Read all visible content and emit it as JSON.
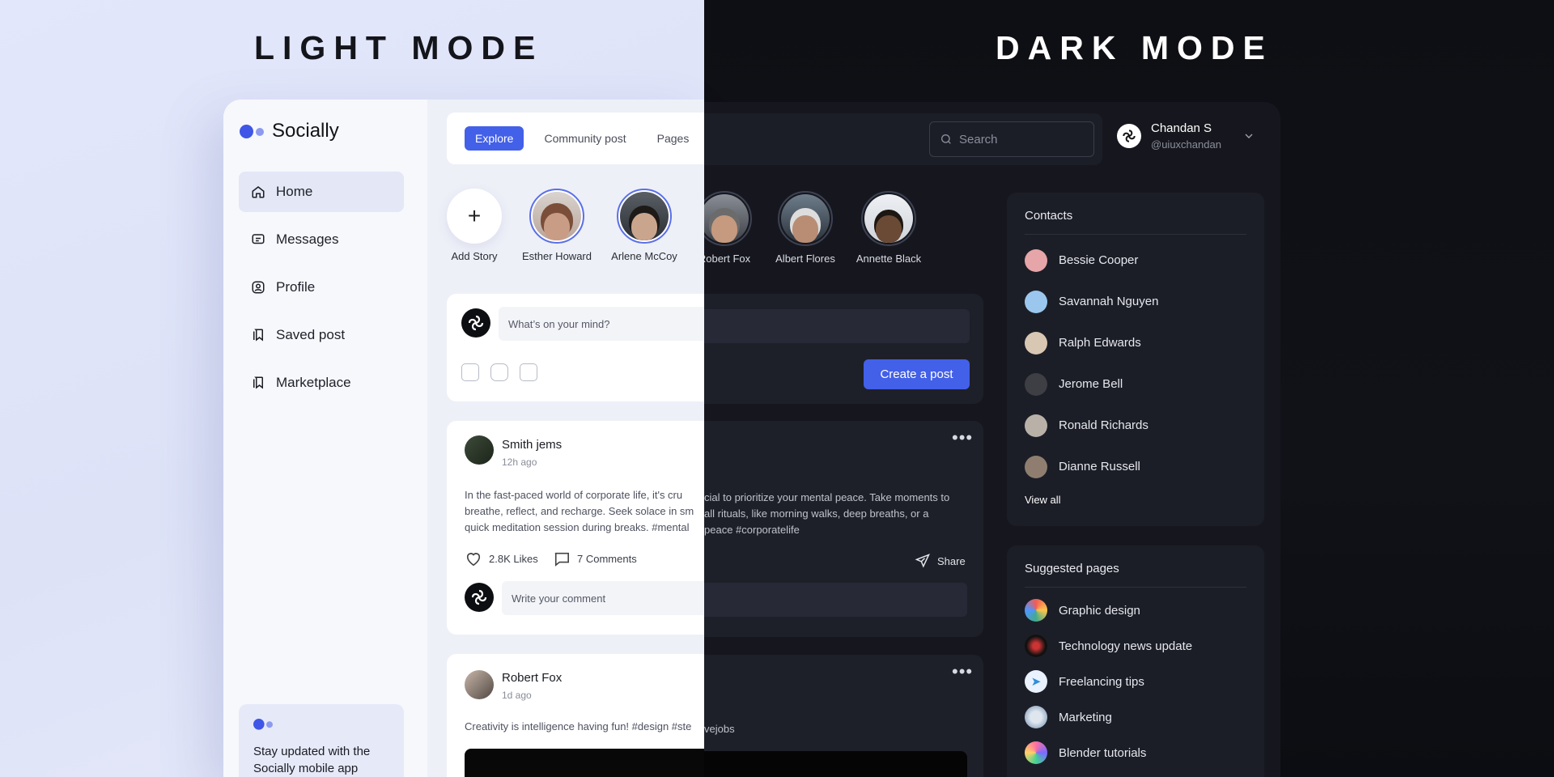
{
  "headings": {
    "light": "LIGHT MODE",
    "dark": "DARK MODE"
  },
  "brand": {
    "name": "Socially",
    "primary_color": "#4360e8"
  },
  "sidebar": {
    "items": [
      {
        "label": "Home",
        "icon": "home-icon",
        "active": true
      },
      {
        "label": "Messages",
        "icon": "message-icon",
        "active": false
      },
      {
        "label": "Profile",
        "icon": "profile-icon",
        "active": false
      },
      {
        "label": "Saved post",
        "icon": "bookmark-icon",
        "active": false
      },
      {
        "label": "Marketplace",
        "icon": "store-icon",
        "active": false
      }
    ],
    "promo_text": "Stay updated with the Socially mobile app"
  },
  "tabs": {
    "explore": "Explore",
    "community": "Community post",
    "pages": "Pages"
  },
  "search": {
    "placeholder": "Search"
  },
  "user": {
    "name": "Chandan S",
    "handle": "@uiuxchandan"
  },
  "stories": {
    "add": "Add Story",
    "items": [
      "Esther Howard",
      "Arlene McCoy",
      "Robert Fox",
      "Albert Flores",
      "Annette Black"
    ]
  },
  "composer": {
    "placeholder": "What’s on your mind?",
    "create": "Create a post"
  },
  "post1": {
    "author": "Smith jems",
    "time": "12h ago",
    "text_left": "In the fast-paced world of corporate life, it's cru",
    "text_right": "cial to prioritize your mental peace. Take moments to",
    "text_left2": "breathe, reflect, and recharge. Seek solace in sm",
    "text_right2": "all rituals, like morning walks, deep breaths, or a",
    "text_left3": "quick meditation session during breaks. #mental",
    "text_right3": "peace #corporatelife",
    "likes": "2.8K Likes",
    "comments": "7 Comments",
    "share": "Share",
    "comment_placeholder": "Write your comment"
  },
  "post2": {
    "author": "Robert Fox",
    "time": "1d ago",
    "text_left": "Creativity is intelligence having fun! #design #ste",
    "text_right": "vejobs"
  },
  "contacts": {
    "title": "Contacts",
    "items": [
      "Bessie Cooper",
      "Savannah Nguyen",
      "Ralph Edwards",
      "Jerome Bell",
      "Ronald Richards",
      "Dianne Russell"
    ],
    "view_all": "View all"
  },
  "suggested": {
    "title": "Suggested pages",
    "items": [
      "Graphic design",
      "Technology news update",
      "Freelancing tips",
      "Marketing",
      "Blender tutorials"
    ]
  }
}
